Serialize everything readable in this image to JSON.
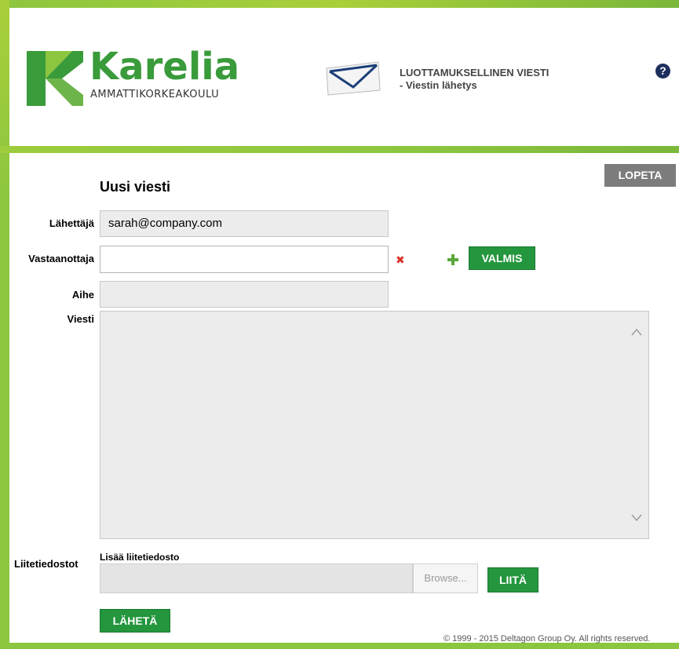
{
  "header": {
    "logo_text": "Karelia",
    "logo_subtext": "AMMATTIKORKEAKOULU",
    "title_line1": "LUOTTAMUKSELLINEN VIESTI",
    "title_line2": "- Viestin lähetys",
    "help_icon": "question-circle-icon"
  },
  "toolbar": {
    "logout_label": "LOPETA"
  },
  "form": {
    "title": "Uusi viesti",
    "sender_label": "Lähettäjä",
    "sender_value": "sarah@company.com",
    "recipient_label": "Vastaanottaja",
    "recipient_value": "",
    "remove_recipient_icon": "remove-x-icon",
    "add_recipient_icon": "plus-icon",
    "done_label": "VALMIS",
    "subject_label": "Aihe",
    "subject_value": "",
    "message_label": "Viesti",
    "message_value": "",
    "attachments_label": "Liitetiedostot",
    "add_attachment_label": "Lisää liitetiedosto",
    "browse_label": "Browse...",
    "attach_label": "LIITÄ",
    "send_label": "LÄHETÄ"
  },
  "footer": {
    "copyright": "© 1999 - 2015 Deltagon Group Oy. All rights reserved."
  },
  "colors": {
    "frame_green": "#8cc63f",
    "button_green": "#24963e",
    "button_gray": "#7c7c7c",
    "brand_green": "#3a9b3b"
  }
}
